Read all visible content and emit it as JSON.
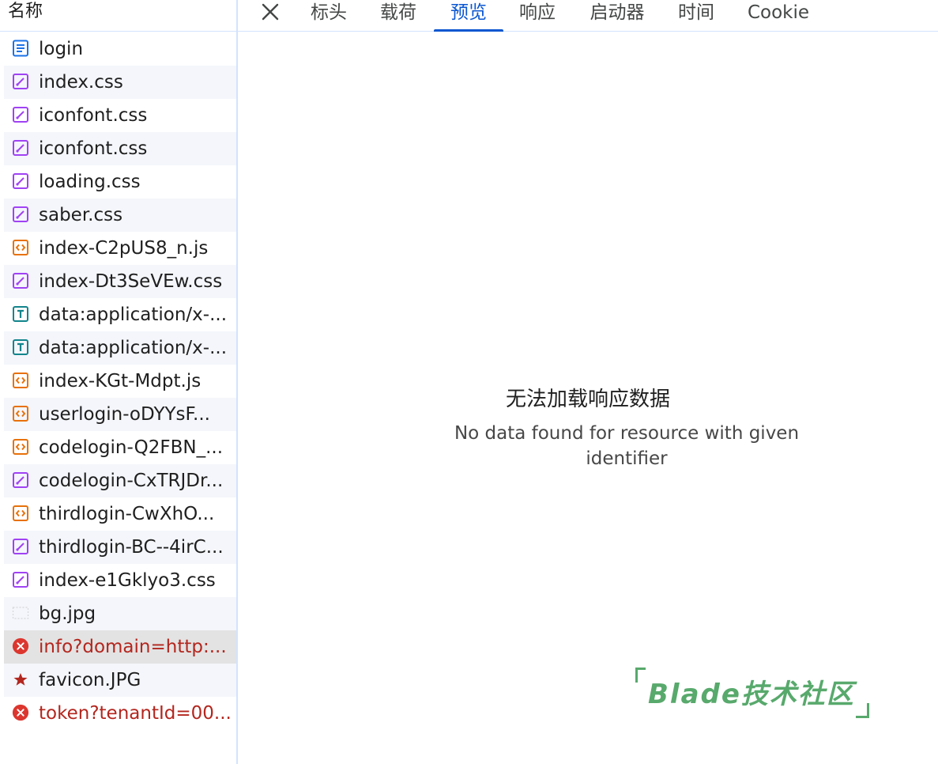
{
  "list": {
    "header": "名称",
    "items": [
      {
        "name": "login",
        "icon": "document-icon",
        "type": "doc",
        "error": false
      },
      {
        "name": "index.css",
        "icon": "stylesheet-icon",
        "type": "css",
        "error": false
      },
      {
        "name": "iconfont.css",
        "icon": "stylesheet-icon",
        "type": "css",
        "error": false
      },
      {
        "name": "iconfont.css",
        "icon": "stylesheet-icon",
        "type": "css",
        "error": false
      },
      {
        "name": "loading.css",
        "icon": "stylesheet-icon",
        "type": "css",
        "error": false
      },
      {
        "name": "saber.css",
        "icon": "stylesheet-icon",
        "type": "css",
        "error": false
      },
      {
        "name": "index-C2pUS8_n.js",
        "icon": "script-icon",
        "type": "js",
        "error": false
      },
      {
        "name": "index-Dt3SeVEw.css",
        "icon": "stylesheet-icon",
        "type": "css",
        "error": false
      },
      {
        "name": "data:application/x-...",
        "icon": "font-icon",
        "type": "font",
        "error": false
      },
      {
        "name": "data:application/x-...",
        "icon": "font-icon",
        "type": "font",
        "error": false
      },
      {
        "name": "index-KGt-Mdpt.js",
        "icon": "script-icon",
        "type": "js",
        "error": false
      },
      {
        "name": "userlogin-oDYYsF...",
        "icon": "script-icon",
        "type": "js",
        "error": false
      },
      {
        "name": "codelogin-Q2FBN_...",
        "icon": "script-icon",
        "type": "js",
        "error": false
      },
      {
        "name": "codelogin-CxTRJDr...",
        "icon": "stylesheet-icon",
        "type": "css",
        "error": false
      },
      {
        "name": "thirdlogin-CwXhO...",
        "icon": "script-icon",
        "type": "js",
        "error": false
      },
      {
        "name": "thirdlogin-BC--4irC...",
        "icon": "stylesheet-icon",
        "type": "css",
        "error": false
      },
      {
        "name": "index-e1Gklyo3.css",
        "icon": "stylesheet-icon",
        "type": "css",
        "error": false
      },
      {
        "name": "bg.jpg",
        "icon": "image-icon",
        "type": "img",
        "error": false
      },
      {
        "name": "info?domain=http:...",
        "icon": "error-icon",
        "type": "error",
        "error": true,
        "selected": true
      },
      {
        "name": "favicon.JPG",
        "icon": "favicon-icon",
        "type": "favicon",
        "error": false
      },
      {
        "name": "token?tenantId=00...",
        "icon": "error-icon",
        "type": "error",
        "error": true
      }
    ]
  },
  "tabs": {
    "close_icon": "close-icon",
    "items": [
      {
        "label": "标头",
        "active": false
      },
      {
        "label": "载荷",
        "active": false
      },
      {
        "label": "预览",
        "active": true
      },
      {
        "label": "响应",
        "active": false
      },
      {
        "label": "启动器",
        "active": false
      },
      {
        "label": "时间",
        "active": false
      },
      {
        "label": "Cookie",
        "active": false
      }
    ]
  },
  "preview": {
    "title": "无法加载响应数据",
    "message": "No data found for resource with given identifier"
  },
  "watermark": {
    "text": "Blade技术社区"
  },
  "colors": {
    "accent": "#0b57d0",
    "error": "#b3261e",
    "css": "#a142f4",
    "js": "#e8710a",
    "font": "#12858c",
    "doc": "#1a73e8",
    "watermark": "#58a96c"
  }
}
